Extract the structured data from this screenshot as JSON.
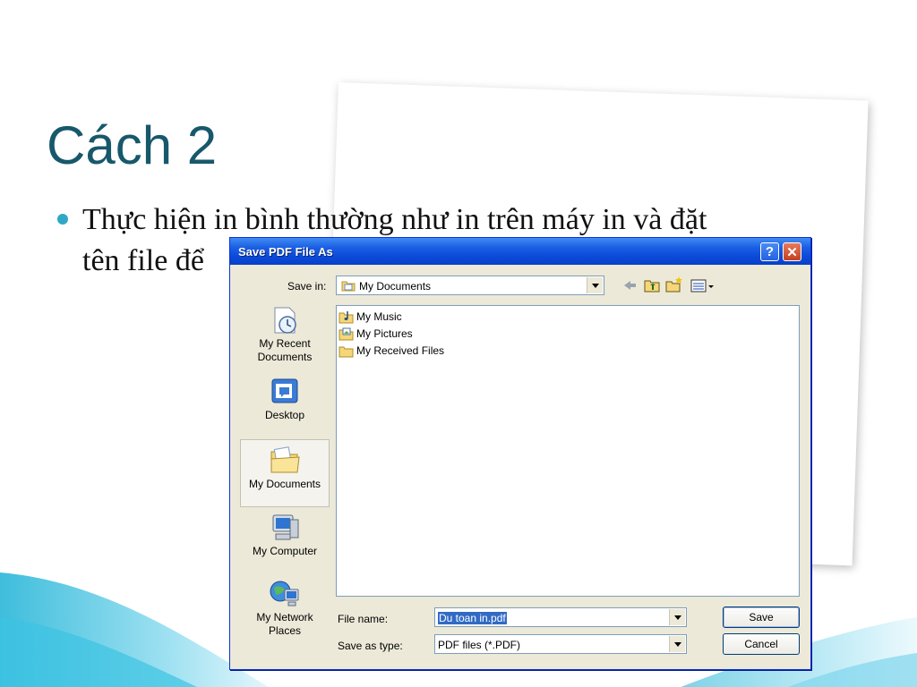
{
  "slide": {
    "title": "Cách 2",
    "bullet_line1": "Thực hiện in bình thường như in trên máy in và đặt",
    "bullet_line2": "tên file để"
  },
  "dialog": {
    "title": "Save PDF File As",
    "save_in_label": "Save in:",
    "save_in_value": "My Documents",
    "places": [
      {
        "label": "My Recent\nDocuments",
        "icon": "recent-documents-icon"
      },
      {
        "label": "Desktop",
        "icon": "desktop-icon"
      },
      {
        "label": "My Documents",
        "icon": "my-documents-icon"
      },
      {
        "label": "My Computer",
        "icon": "my-computer-icon"
      },
      {
        "label": "My Network\nPlaces",
        "icon": "network-places-icon"
      }
    ],
    "files": [
      {
        "name": "My Music",
        "icon": "music-folder-icon"
      },
      {
        "name": "My Pictures",
        "icon": "pictures-folder-icon"
      },
      {
        "name": "My Received Files",
        "icon": "folder-icon"
      }
    ],
    "file_name_label": "File name:",
    "file_name_value": "Du toan in.pdf",
    "save_as_type_label": "Save as type:",
    "save_as_type_value": "PDF files (*.PDF)",
    "save_button": "Save",
    "cancel_button": "Cancel"
  },
  "colors": {
    "title": "#17586b",
    "bullet": "#2fa8c4",
    "titlebar": "#0a4ad9",
    "dialog_bg": "#ece9d8"
  }
}
